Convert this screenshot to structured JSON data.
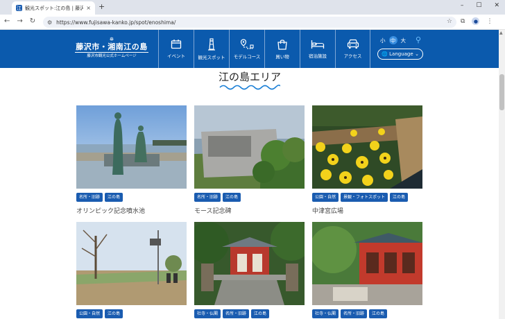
{
  "browser": {
    "tab_title": "観光スポット:江の島 | 藤沢市観光",
    "tab_close": "×",
    "new_tab": "+",
    "url": "https://www.fujisawa-kanko.jp/spot/enoshima/",
    "win_min": "–",
    "win_max": "☐",
    "win_close": "✕"
  },
  "site": {
    "logo_main": "藤沢市・湘南江の島",
    "logo_sub": "藤沢市観光公式ホームページ",
    "menu": [
      {
        "label": "イベント",
        "icon": "calendar-icon"
      },
      {
        "label": "観光スポット",
        "icon": "lighthouse-icon"
      },
      {
        "label": "モデルコース",
        "icon": "map-route-icon"
      },
      {
        "label": "買い物",
        "icon": "shopping-bag-icon"
      },
      {
        "label": "宿泊施設",
        "icon": "bed-icon"
      },
      {
        "label": "アクセス",
        "icon": "car-icon"
      }
    ],
    "font_small": "小",
    "font_mid": "中",
    "font_large": "大",
    "language": "Language"
  },
  "page": {
    "title": "江の島エリア"
  },
  "cards": [
    {
      "name": "オリンピック記念噴水池",
      "tags": [
        "名所・旧跡",
        "江の島"
      ]
    },
    {
      "name": "モース記念碑",
      "tags": [
        "名所・旧跡",
        "江の島"
      ]
    },
    {
      "name": "中津宮広場",
      "tags": [
        "公園・自然",
        "景観・フォトスポット",
        "江の島"
      ]
    },
    {
      "name": "",
      "tags": [
        "公園・自然",
        "江の島"
      ]
    },
    {
      "name": "",
      "tags": [
        "社寺・仏閣",
        "名所・旧跡",
        "江の島"
      ]
    },
    {
      "name": "",
      "tags": [
        "社寺・仏閣",
        "名所・旧跡",
        "江の島"
      ]
    }
  ],
  "colors": {
    "brand": "#0b5aad",
    "tag": "#1a5cb0"
  }
}
